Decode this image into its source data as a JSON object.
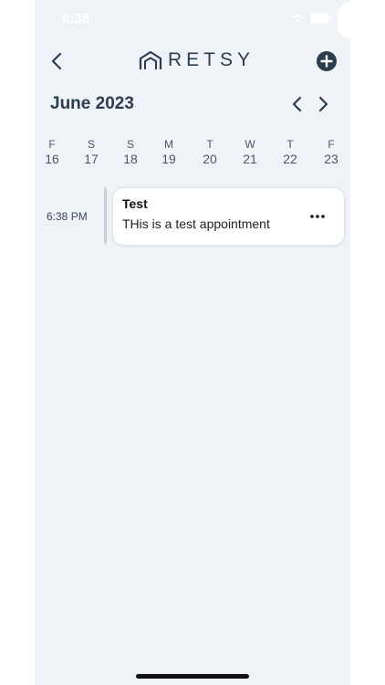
{
  "status_bar": {
    "time": "6:38"
  },
  "header": {
    "logo_text": "RETSY",
    "back_icon": "chevron-left-icon",
    "add_icon": "plus-circle-icon"
  },
  "calendar": {
    "month_title": "June 2023",
    "days": [
      {
        "letter": "F",
        "num": "16"
      },
      {
        "letter": "S",
        "num": "17"
      },
      {
        "letter": "S",
        "num": "18"
      },
      {
        "letter": "M",
        "num": "19"
      },
      {
        "letter": "T",
        "num": "20"
      },
      {
        "letter": "W",
        "num": "21"
      },
      {
        "letter": "T",
        "num": "22"
      },
      {
        "letter": "F",
        "num": "23"
      }
    ]
  },
  "appointments": [
    {
      "time": "6:38 PM",
      "title": "Test",
      "description": "THis is a test appointment"
    }
  ],
  "colors": {
    "background": "#eff3f7",
    "brand": "#2b3d4f",
    "card": "#ffffff"
  }
}
